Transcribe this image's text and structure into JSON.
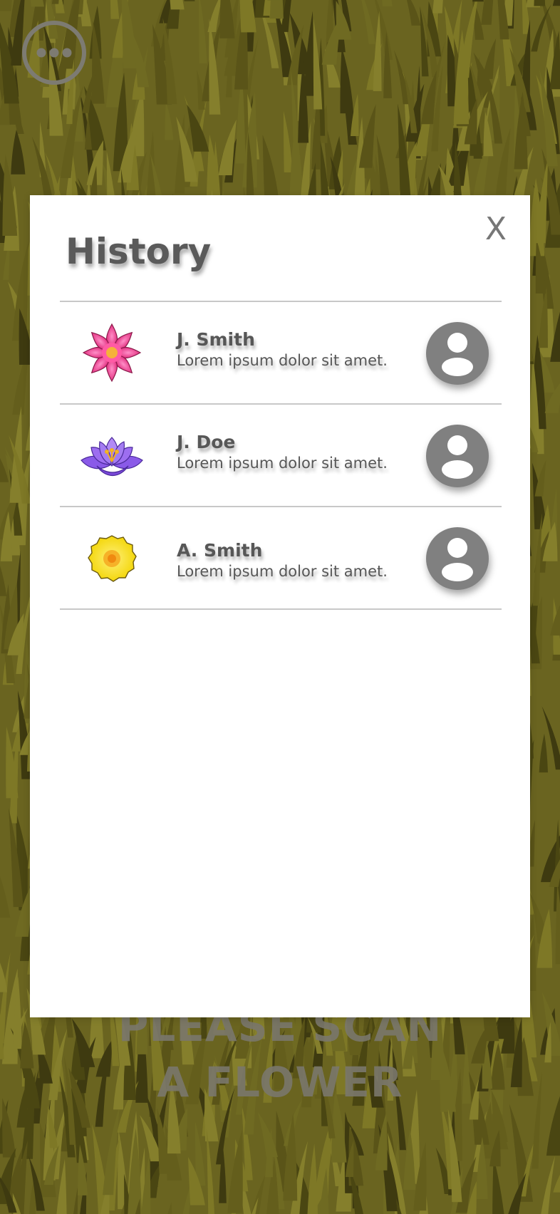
{
  "background": {
    "description_icon": "grass-texture"
  },
  "menu": {
    "icon": "more-horizontal-icon"
  },
  "scan_prompt": {
    "line1": "PLEASE SCAN",
    "line2": "A FLOWER"
  },
  "modal": {
    "title": "History",
    "close_label": "X"
  },
  "history": [
    {
      "name": "J. Smith",
      "description": "Lorem ipsum dolor sit amet.",
      "flower_icon": "pink-flower-icon"
    },
    {
      "name": "J. Doe",
      "description": "Lorem ipsum dolor sit amet.",
      "flower_icon": "purple-lotus-icon"
    },
    {
      "name": "A. Smith",
      "description": "Lorem ipsum dolor sit amet.",
      "flower_icon": "yellow-flower-icon"
    }
  ],
  "colors": {
    "grass": "#6a6420",
    "text": "#575757",
    "icon_grey": "#808080",
    "divider": "#c8c8c8"
  }
}
